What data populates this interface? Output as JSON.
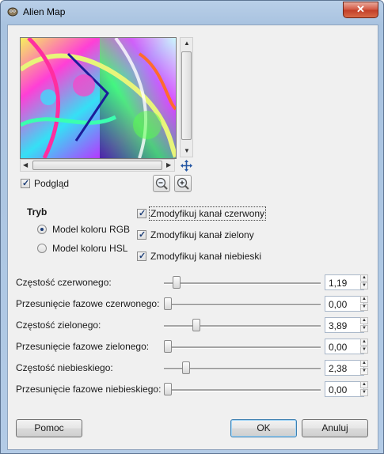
{
  "window": {
    "title": "Alien Map",
    "close_label": "✕"
  },
  "preview": {
    "label": "Podgląd",
    "checked": true
  },
  "mode": {
    "title": "Tryb",
    "options": [
      {
        "label": "Model koloru RGB",
        "selected": true
      },
      {
        "label": "Model koloru HSL",
        "selected": false
      }
    ]
  },
  "channels": [
    {
      "label": "Zmodyfikuj kanał czerwony",
      "checked": true
    },
    {
      "label": "Zmodyfikuj kanał zielony",
      "checked": true
    },
    {
      "label": "Zmodyfikuj kanał niebieski",
      "checked": true
    }
  ],
  "sliders": [
    {
      "label": "Częstość czerwonego:",
      "value": "1,19",
      "fraction": 0.06
    },
    {
      "label": "Przesunięcie fazowe czerwonego:",
      "value": "0,00",
      "fraction": 0.0
    },
    {
      "label": "Częstość zielonego:",
      "value": "3,89",
      "fraction": 0.19
    },
    {
      "label": "Przesunięcie fazowe zielonego:",
      "value": "0,00",
      "fraction": 0.0
    },
    {
      "label": "Częstość niebieskiego:",
      "value": "2,38",
      "fraction": 0.12
    },
    {
      "label": "Przesunięcie fazowe niebieskiego:",
      "value": "0,00",
      "fraction": 0.0
    }
  ],
  "buttons": {
    "help": "Pomoc",
    "ok": "OK",
    "cancel": "Anuluj"
  },
  "colors": {
    "accent": "#1d3e77",
    "close": "#c13e28"
  },
  "icons": {
    "app": "gimp-icon",
    "move": "move-arrows-icon",
    "zoom_out": "zoom-out-icon",
    "zoom_in": "zoom-in-icon"
  }
}
